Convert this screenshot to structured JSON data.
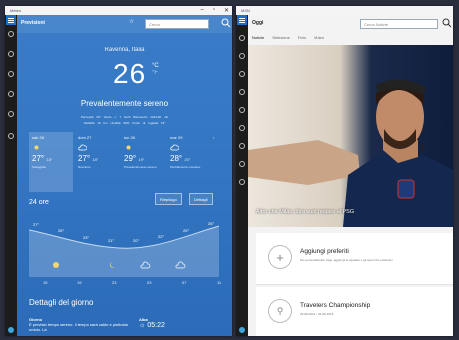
{
  "meteo": {
    "window_title": "Meteo",
    "header_title": "Previsioni",
    "search_placeholder": "Cerca",
    "city": "Ravenna, Italia",
    "temperature": "26",
    "units": [
      "°C",
      "°F"
    ],
    "condition": "Prevalentemente sereno",
    "details_row1": "Percepita  26°    Vento  ↙ 7 km/h    Barometro  1014,00 mb",
    "details_row2": "Visibilità  10 km    Umidità  59%    Punto di rugiada  15°",
    "days": [
      {
        "name": "sab 26",
        "hi": "27°",
        "lo": "18°",
        "desc": "Soleggiato",
        "icon": "sun-icon"
      },
      {
        "name": "dom 27",
        "hi": "27°",
        "lo": "18°",
        "desc": "Nuvoloso",
        "icon": "cloud-icon"
      },
      {
        "name": "lun 28",
        "hi": "29°",
        "lo": "19°",
        "desc": "Prevalentemente sereno",
        "icon": "sun-icon"
      },
      {
        "name": "mar 29",
        "hi": "28°",
        "lo": "20°",
        "desc": "Parzialmente nuvoloso",
        "icon": "cloud-icon"
      }
    ],
    "hourly_title": "24 ore",
    "btn_riepilogo": "Riepilogo",
    "btn_dettagli": "Dettagli",
    "hourly_hours": [
      "15",
      "19",
      "23",
      "03",
      "07",
      "11"
    ],
    "hourly_temps": [
      "27°",
      "26°",
      "23°",
      "21°",
      "20°",
      "22°",
      "25°",
      "26°"
    ],
    "details_title": "Dettagli del giorno",
    "day_col_title": "Giorno",
    "day_col_text": "È previsto tempo sereno. Il tempo sarà caldo e piuttosto umido. La",
    "alba_title": "Alba",
    "alba_time": "05:22"
  },
  "news": {
    "window_title": "MSN",
    "header_title": "Oggi",
    "search_placeholder": "Cerca Notizie",
    "tabs": [
      "Notizie",
      "Selezione",
      "Foto",
      "Video"
    ],
    "headline": "Altro che Milan, Ibra vuol restare al PSG",
    "headline_source": "Calciomercato.com · 10 minuti",
    "cards": [
      {
        "title": "Aggiungi preferiti",
        "subtitle": "Per personalizzare l'app, aggiungi le squadre e gli sport che preferisci",
        "icon": "plus-icon"
      },
      {
        "title": "Travelers Championship",
        "subtitle": "23-06-2016 - 26-06-2016",
        "icon": "pin-icon"
      }
    ]
  },
  "colors": {
    "accent": "#1b6fc8",
    "weather_bg": "#3477c3"
  }
}
